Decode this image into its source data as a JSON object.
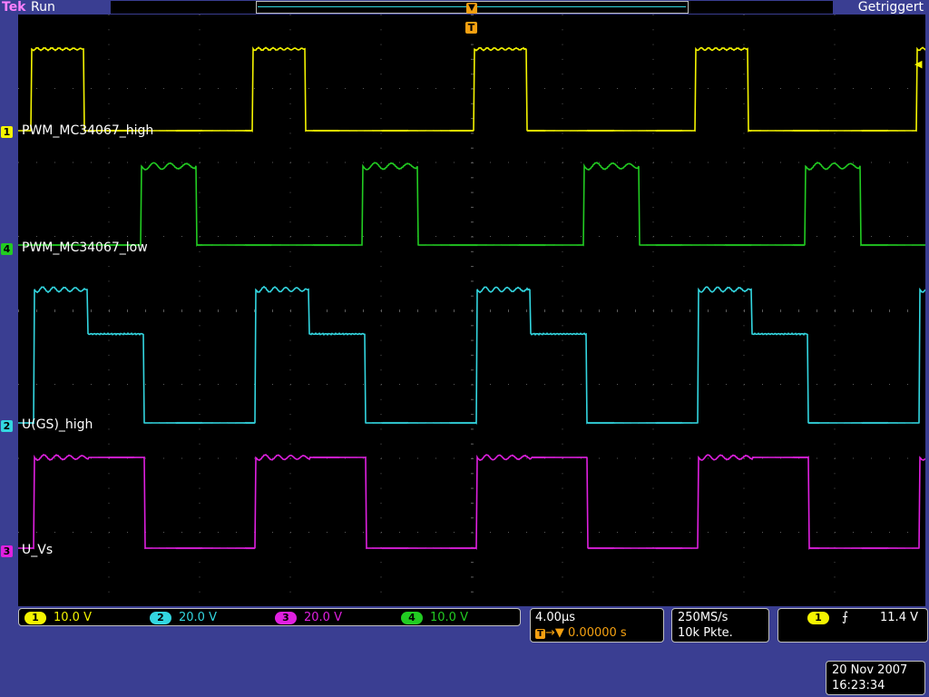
{
  "header": {
    "brand": "Tek",
    "run_state": "Run",
    "trigger_status": "Getriggert",
    "trigger_marker": "T"
  },
  "channels": [
    {
      "id": "1",
      "name": "PWM_MC34067_high",
      "scale": "10.0 V",
      "color": "#f4f400"
    },
    {
      "id": "4",
      "name": "PWM_MC34067_low",
      "scale": "10.0 V",
      "color": "#22cc22"
    },
    {
      "id": "2",
      "name": "U(GS)_high",
      "scale": "20.0 V",
      "color": "#33d6e0"
    },
    {
      "id": "3",
      "name": "U_Vs",
      "scale": "20.0 V",
      "color": "#e020e0"
    }
  ],
  "scales": [
    {
      "ch": "1",
      "value": "10.0 V",
      "color": "#f4f400"
    },
    {
      "ch": "2",
      "value": "20.0 V",
      "color": "#33d6e0"
    },
    {
      "ch": "3",
      "value": "20.0 V",
      "color": "#e020e0"
    },
    {
      "ch": "4",
      "value": "10.0 V",
      "color": "#22cc22"
    }
  ],
  "timebase": {
    "time_per_div": "4.00µs",
    "trigger_badge": "T",
    "arrow": "→▼",
    "position": "0.00000 s"
  },
  "acquisition": {
    "sample_rate": "250MS/s",
    "record_length": "10k Pkte."
  },
  "trigger": {
    "source": "1",
    "edge": "rising",
    "edge_symbol": "⨍",
    "level": "11.4 V"
  },
  "datetime": {
    "date": "20 Nov 2007",
    "time": "16:23:34"
  },
  "colors": {
    "background": "#3a3e92",
    "plot": "#000000",
    "grid": "#5a5a5a",
    "accent": "#f4a011"
  }
}
